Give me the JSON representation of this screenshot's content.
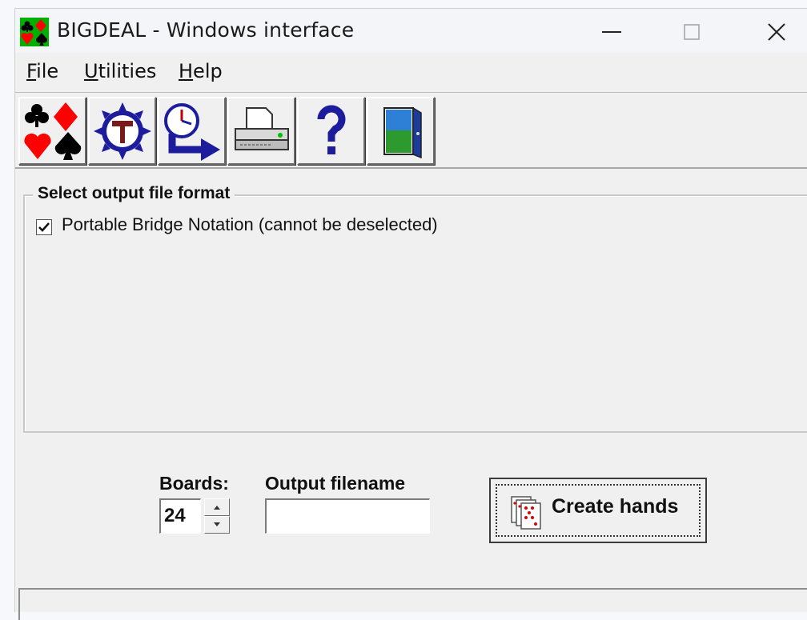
{
  "window": {
    "title": "BIGDEAL - Windows interface"
  },
  "menu": {
    "file": {
      "accel": "F",
      "rest": "ile"
    },
    "utilities": {
      "accel": "U",
      "rest": "tilities"
    },
    "help": {
      "accel": "H",
      "rest": "elp"
    }
  },
  "toolbar": {
    "buttons": [
      {
        "icon": "card-suits-icon"
      },
      {
        "icon": "tools-gear-icon"
      },
      {
        "icon": "clock-arrow-icon"
      },
      {
        "icon": "printer-icon"
      },
      {
        "icon": "help-question-icon"
      },
      {
        "icon": "exit-door-icon"
      }
    ]
  },
  "output_format": {
    "legend": "Select output file format",
    "pbn_label": "Portable Bridge Notation (cannot be deselected)",
    "pbn_checked": true
  },
  "boards": {
    "label": "Boards:",
    "value": "24"
  },
  "output_filename": {
    "label": "Output filename",
    "value": ""
  },
  "create_hands": {
    "label": "Create hands"
  },
  "colors": {
    "suit_red": "#ff0000",
    "suit_black": "#000000",
    "icon_blue": "#1c1c9c",
    "app_icon_green": "#00b000"
  }
}
